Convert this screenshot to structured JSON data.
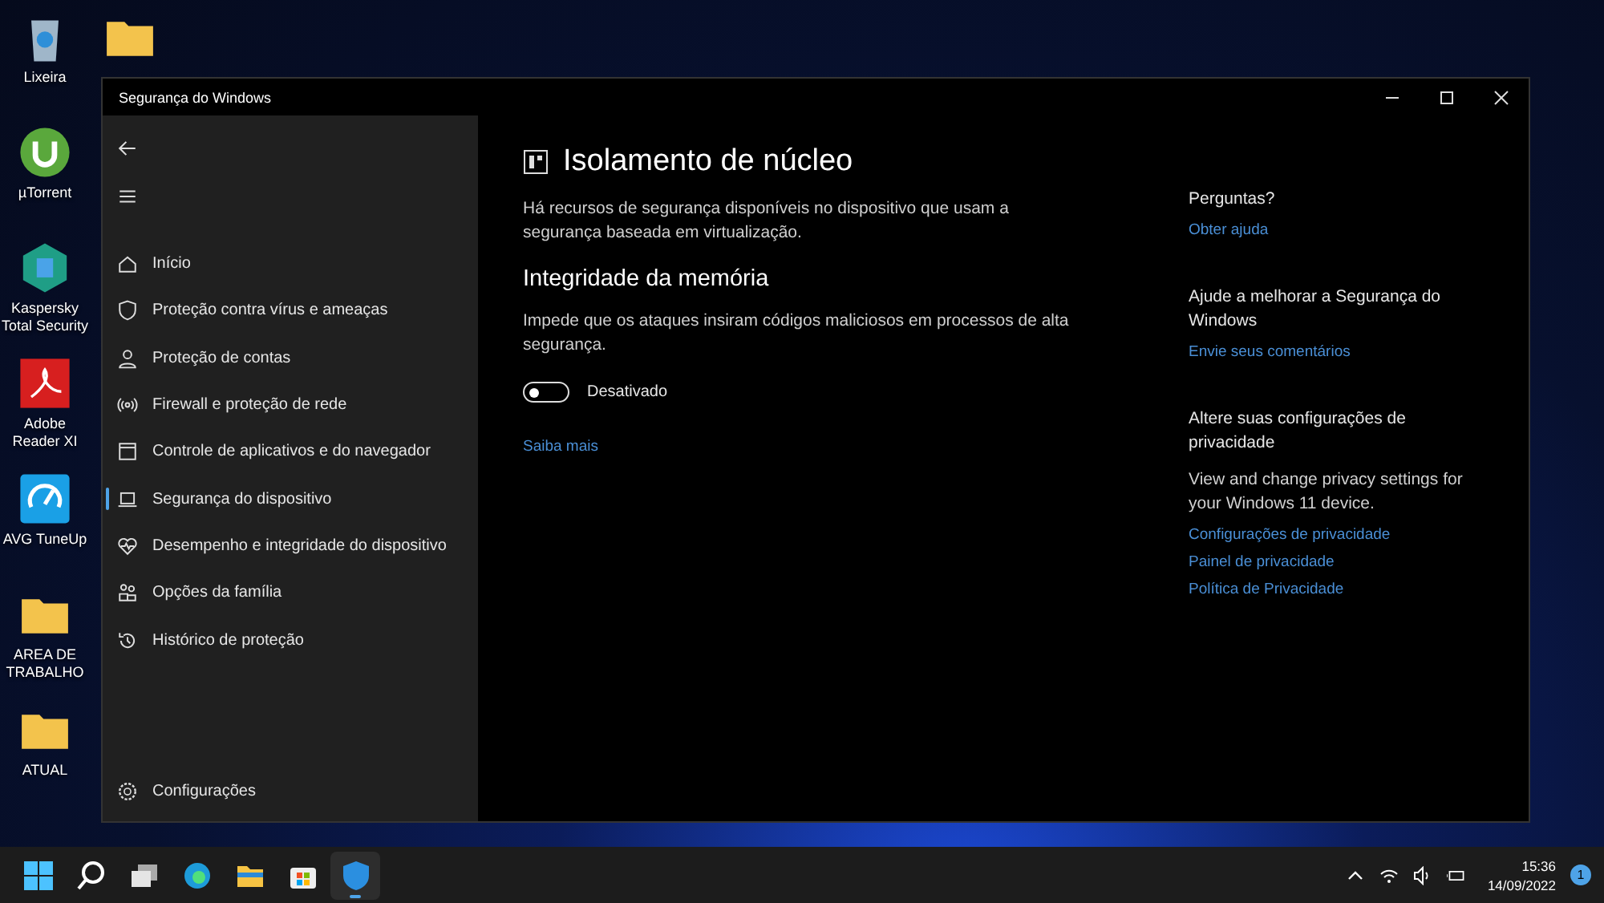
{
  "desktop_icons": [
    {
      "label": "Lixeira",
      "kind": "bin"
    },
    {
      "label": "µTorrent",
      "kind": "torrent"
    },
    {
      "label": "Kaspersky Total Security",
      "kind": "kaspersky"
    },
    {
      "label": "Adobe Reader XI",
      "kind": "pdf"
    },
    {
      "label": "AVG TuneUp",
      "kind": "tuneup"
    },
    {
      "label": "AREA DE TRABALHO",
      "kind": "folder"
    },
    {
      "label": "ATUAL",
      "kind": "folder"
    }
  ],
  "window": {
    "title": "Segurança do Windows"
  },
  "sidebar": {
    "items": [
      {
        "label": "Início",
        "kind": "home",
        "selected": false
      },
      {
        "label": "Proteção contra vírus e ameaças",
        "kind": "shield",
        "selected": false
      },
      {
        "label": "Proteção de contas",
        "kind": "person",
        "selected": false
      },
      {
        "label": "Firewall e proteção de rede",
        "kind": "signal",
        "selected": false
      },
      {
        "label": "Controle de aplicativos e do navegador",
        "kind": "browser",
        "selected": false
      },
      {
        "label": "Segurança do dispositivo",
        "kind": "laptop",
        "selected": true
      },
      {
        "label": "Desempenho e integridade do dispositivo",
        "kind": "heart",
        "selected": false
      },
      {
        "label": "Opções da família",
        "kind": "family",
        "selected": false
      },
      {
        "label": "Histórico de proteção",
        "kind": "history",
        "selected": false
      }
    ],
    "settings": "Configurações"
  },
  "main": {
    "title": "Isolamento de núcleo",
    "intro": "Há recursos de segurança disponíveis no dispositivo que usam a segurança baseada em virtualização.",
    "section_title": "Integridade da memória",
    "section_text": "Impede que os ataques insiram códigos maliciosos em processos de alta segurança.",
    "toggle": {
      "on": false,
      "label": "Desativado"
    },
    "link": "Saiba mais"
  },
  "aside": [
    {
      "heading": "Perguntas?",
      "links": [
        "Obter ajuda"
      ]
    },
    {
      "heading": "Ajude a melhorar a Segurança do Windows",
      "links": [
        "Envie seus comentários"
      ]
    },
    {
      "heading": "Altere suas configurações de privacidade",
      "text": "View and change privacy settings for your Windows 11 device.",
      "links": [
        "Configurações de privacidade",
        "Painel de privacidade",
        "Política de Privacidade"
      ]
    }
  ],
  "taskbar": {
    "apps": [
      {
        "kind": "start",
        "active": false
      },
      {
        "kind": "search",
        "active": false
      },
      {
        "kind": "taskview",
        "active": false
      },
      {
        "kind": "edge",
        "active": false
      },
      {
        "kind": "explorer",
        "active": false
      },
      {
        "kind": "store",
        "active": false
      },
      {
        "kind": "security",
        "active": true
      }
    ],
    "time": "15:36",
    "date": "14/09/2022",
    "notifications": "1"
  }
}
